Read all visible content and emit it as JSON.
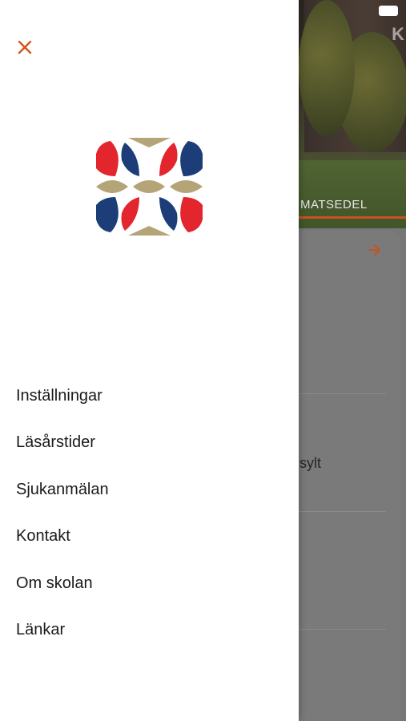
{
  "background": {
    "hero_sign_letter": "K",
    "active_tab_label": "MATSEDEL",
    "card_text_fragment": "sylt",
    "accent_color": "#c6541e"
  },
  "drawer": {
    "close_icon": "close-icon",
    "logo_icon": "school-logo",
    "menu_items": [
      {
        "label": "Inställningar"
      },
      {
        "label": "Läsårstider"
      },
      {
        "label": "Sjukanmälan"
      },
      {
        "label": "Kontakt"
      },
      {
        "label": "Om skolan"
      },
      {
        "label": "Länkar"
      }
    ]
  },
  "colors": {
    "logo_red": "#e3252d",
    "logo_navy": "#1c3d78",
    "logo_gold": "#b5a478",
    "close_orange": "#d9531e"
  }
}
